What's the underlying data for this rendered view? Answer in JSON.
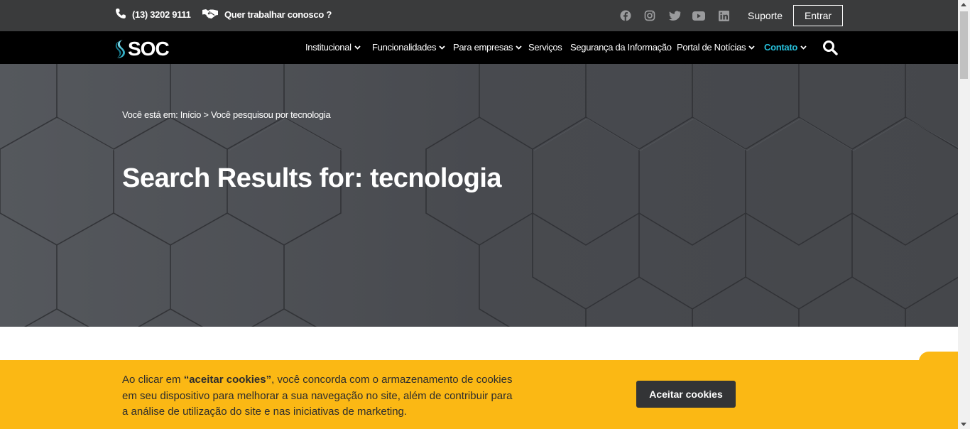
{
  "topbar": {
    "phone": "(13) 3202 9111",
    "jobs": "Quer trabalhar conosco ?",
    "social": [
      "facebook-icon",
      "instagram-icon",
      "twitter-icon",
      "youtube-icon",
      "linkedin-icon"
    ],
    "support": "Suporte",
    "login": "Entrar"
  },
  "nav": {
    "logo": "SOC",
    "items": [
      {
        "label": "Institucional"
      },
      {
        "label": "Funcionalidades"
      },
      {
        "label": "Para empresas"
      },
      {
        "label": "Serviços"
      },
      {
        "label": "Segurança da Informação"
      },
      {
        "label": "Portal de Notícias"
      },
      {
        "label": "Contato"
      }
    ]
  },
  "hero": {
    "breadcrumb_prefix": "Você está em:",
    "breadcrumb_home": "Início",
    "breadcrumb_separator": ">",
    "breadcrumb_current": "Você pesquisou por tecnologia",
    "title": "Search Results for: tecnologia"
  },
  "cookie": {
    "text_before": "Ao clicar em ",
    "text_bold": "“aceitar cookies”",
    "text_after": ", você concorda com o armazenamento de cookies em seu dispositivo para melhorar a sua navegação no site, além de contribuir para a análise de utilização do site e nas iniciativas de marketing.",
    "button": "Aceitar cookies"
  },
  "colors": {
    "topbar": "#3a3b3c",
    "navbar": "#000000",
    "accent": "#27c1dc",
    "hero": "#4b4d52",
    "cookie": "#fbb814",
    "button": "#333436"
  }
}
